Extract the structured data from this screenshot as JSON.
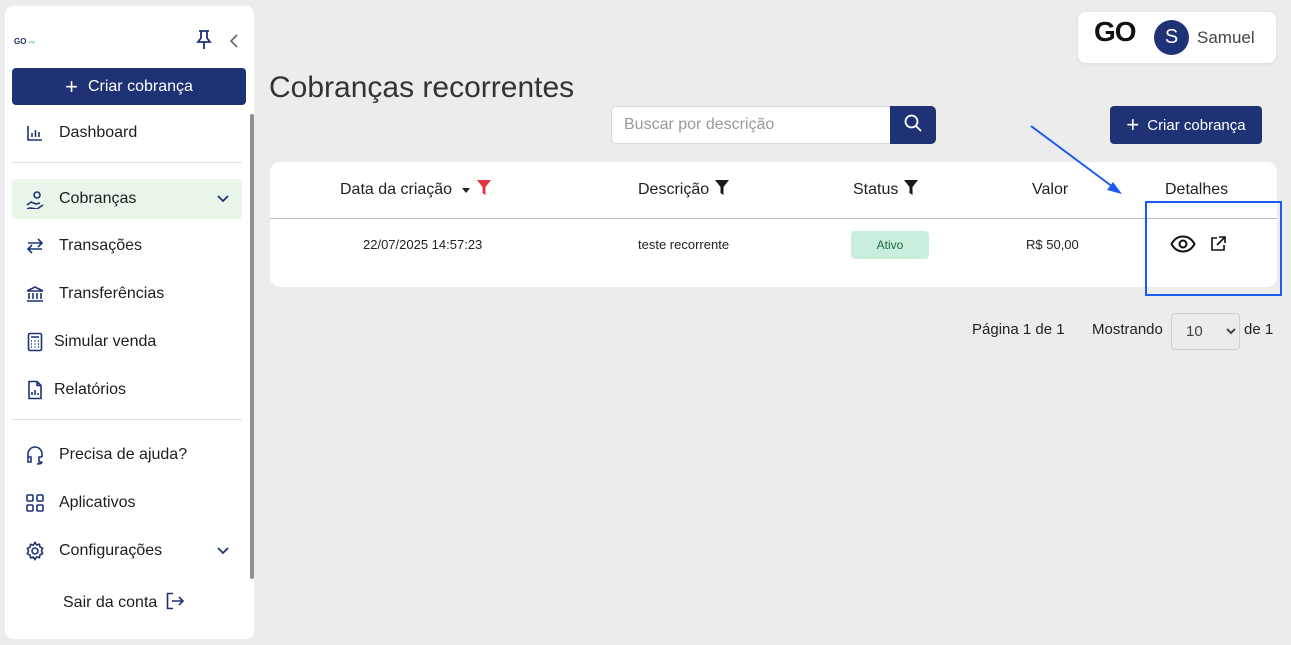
{
  "sidebar": {
    "logo": {
      "main": "GO",
      "sub": "pay"
    },
    "create_label": "Criar cobrança",
    "items": [
      {
        "label": "Dashboard",
        "icon": "bar-chart-icon"
      },
      {
        "label": "Cobranças",
        "icon": "hand-money-icon",
        "active": true
      },
      {
        "label": "Transações",
        "icon": "arrows-swap-icon"
      },
      {
        "label": "Transferências",
        "icon": "bank-icon"
      },
      {
        "label": "Simular venda",
        "icon": "calculator-icon"
      },
      {
        "label": "Relatórios",
        "icon": "report-icon"
      },
      {
        "label": "Precisa de ajuda?",
        "icon": "headset-icon"
      },
      {
        "label": "Aplicativos",
        "icon": "grid-icon"
      },
      {
        "label": "Configurações",
        "icon": "gear-icon"
      }
    ],
    "logout_label": "Sair da conta"
  },
  "user": {
    "brand": "GO",
    "avatar_initial": "S",
    "name": "Samuel"
  },
  "page": {
    "title": "Cobranças recorrentes",
    "search_placeholder": "Buscar por descrição",
    "create_label": "Criar cobrança"
  },
  "table": {
    "columns": [
      "Data da criação",
      "Descrição",
      "Status",
      "Valor",
      "Detalhes"
    ],
    "rows": [
      {
        "date": "22/07/2025 14:57:23",
        "description": "teste recorrente",
        "status": "Ativo",
        "value": "R$ 50,00"
      }
    ]
  },
  "pagination": {
    "page_text": "Página 1 de 1",
    "showing_label": "Mostrando",
    "page_size": "10",
    "page_size_options": [
      "10"
    ],
    "suffix": "de 1"
  },
  "colors": {
    "primary": "#1f3275",
    "active_bg": "#eaf6ea",
    "status_bg": "#c9eedb",
    "filter_red": "#e3343d",
    "annotation_blue": "#1a5cf0"
  }
}
